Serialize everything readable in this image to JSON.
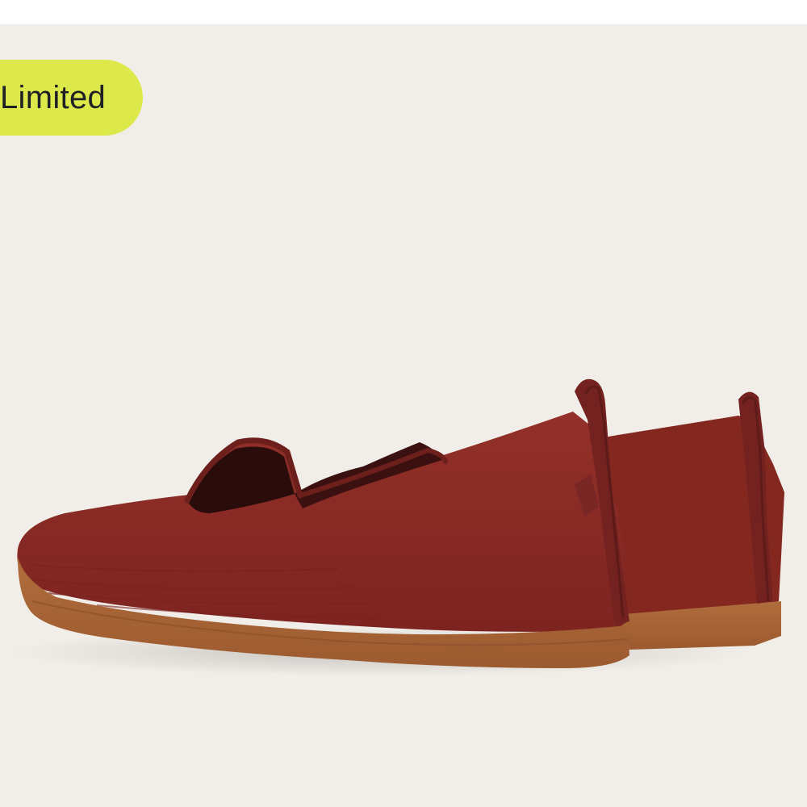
{
  "badge": {
    "label": "Limited"
  },
  "product_image": {
    "icon": "red-knit-flat-shoes-image"
  },
  "colors": {
    "background": "#f1eee9",
    "badge": "#dde94a",
    "upper": "#8b2a25",
    "heel_tab": "#7a2423",
    "sole": "#a56436"
  }
}
